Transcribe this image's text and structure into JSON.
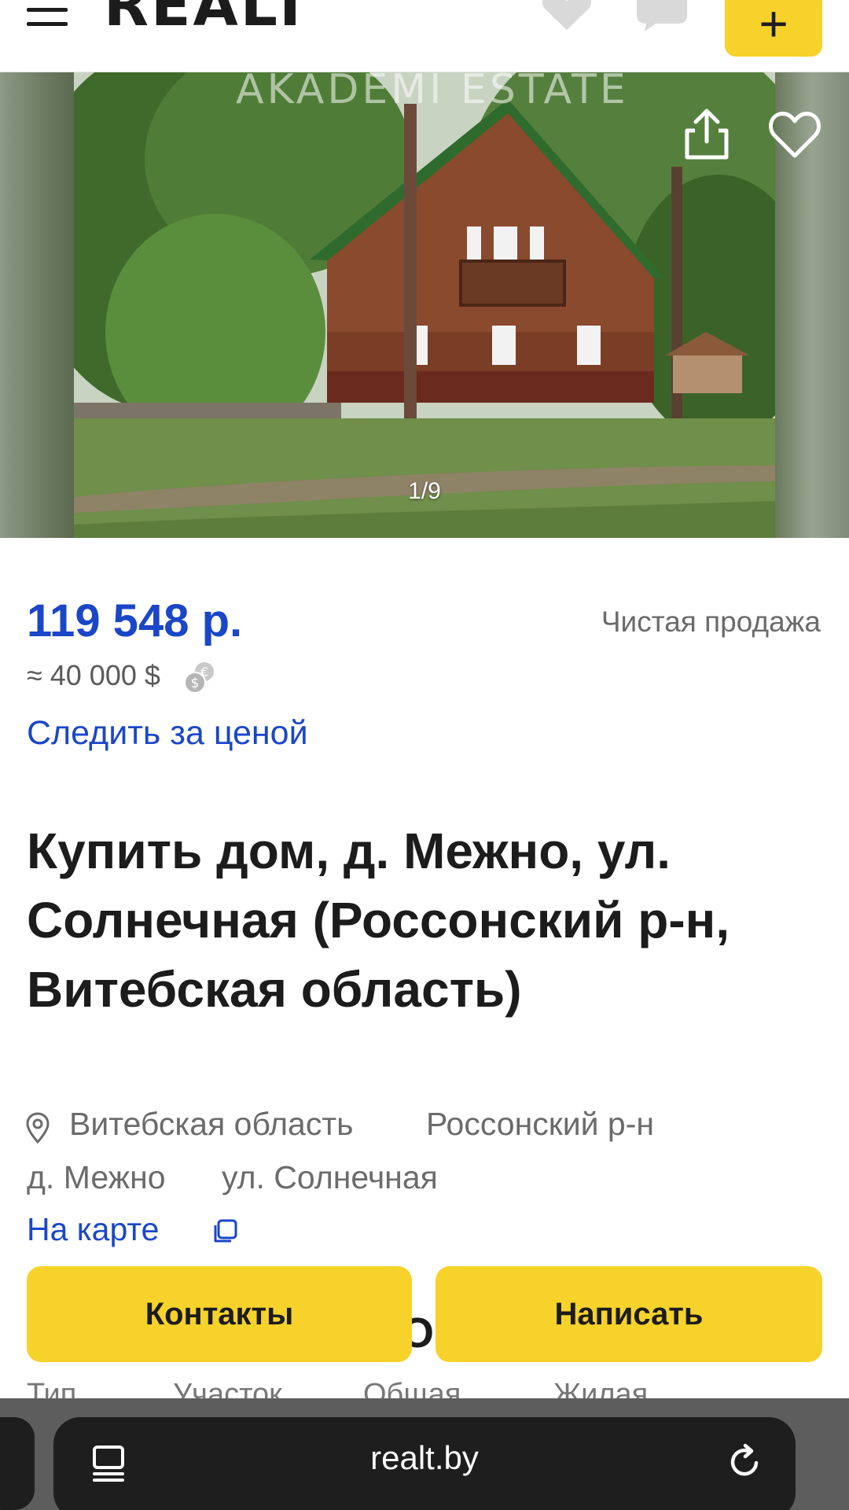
{
  "header": {
    "logo": "REALT",
    "add_label": "+"
  },
  "gallery": {
    "watermark": "AKADEMI ESTATE",
    "counter": "1/9"
  },
  "listing": {
    "price": "119 548 р.",
    "price_usd": "≈ 40 000 $",
    "deal_type": "Чистая продажа",
    "watch_price": "Следить за ценой",
    "title": "Купить дом, д. Межно, ул. Солнечная (Россонский р-н, Витебская область)",
    "address": {
      "region": "Витебская область",
      "district": "Россонский р-н",
      "village": "д. Межно",
      "street": "ул. Солнечная"
    },
    "map_link": "На карте",
    "peek_heading": "О",
    "peek_columns": [
      "Тип",
      "Участок",
      "Общая",
      "Жилая"
    ]
  },
  "actions": {
    "contacts": "Контакты",
    "write": "Написать"
  },
  "browser": {
    "url": "realt.by"
  },
  "colors": {
    "accent_yellow": "#f7d22b",
    "link_blue": "#1a46c8"
  }
}
